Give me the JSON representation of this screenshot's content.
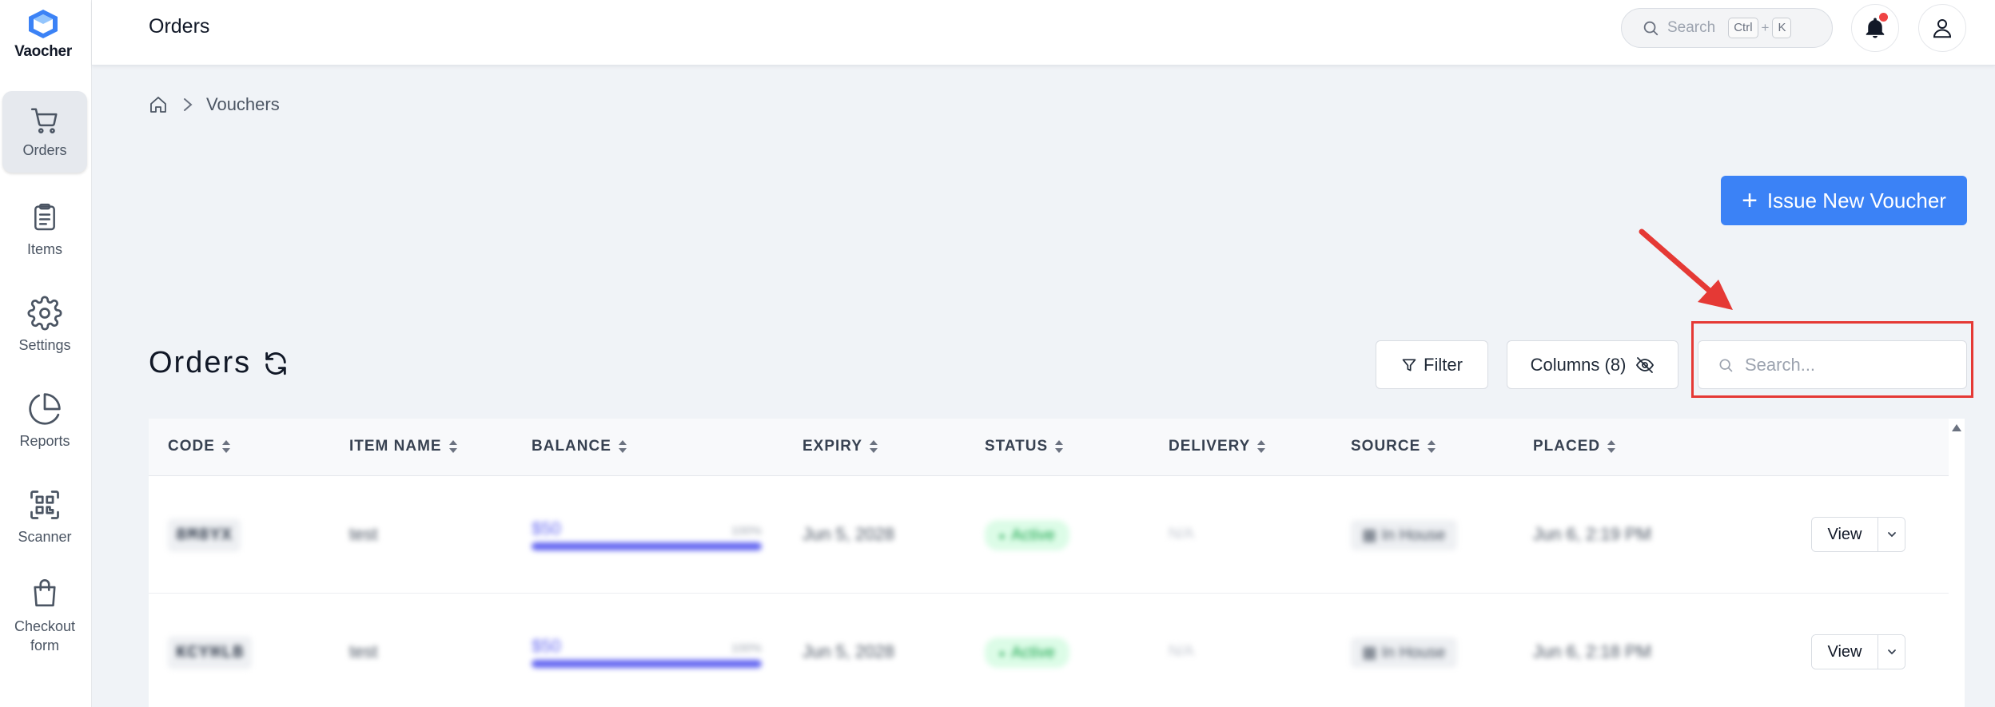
{
  "app": {
    "brand": "Vaocher"
  },
  "sidebar": {
    "items": [
      {
        "label": "Orders",
        "icon": "cart-icon",
        "active": true
      },
      {
        "label": "Items",
        "icon": "clipboard-icon",
        "active": false
      },
      {
        "label": "Settings",
        "icon": "gear-icon",
        "active": false
      },
      {
        "label": "Reports",
        "icon": "pie-chart-icon",
        "active": false
      },
      {
        "label": "Scanner",
        "icon": "qr-scan-icon",
        "active": false
      },
      {
        "label": "Checkout form",
        "icon": "shopping-bag-icon",
        "active": false
      }
    ]
  },
  "header": {
    "title": "Orders",
    "search": {
      "label": "Search",
      "kbd_ctrl": "Ctrl",
      "kbd_plus": "+",
      "kbd_key": "K"
    },
    "has_notification": true
  },
  "breadcrumb": {
    "home_icon": "home-icon",
    "current": "Vouchers"
  },
  "actions": {
    "issue_label": "Issue New Voucher"
  },
  "section": {
    "title": "Orders",
    "filter_label": "Filter",
    "columns_label": "Columns (8)",
    "search_placeholder": "Search..."
  },
  "table": {
    "columns": [
      "CODE",
      "ITEM NAME",
      "BALANCE",
      "EXPIRY",
      "STATUS",
      "DELIVERY",
      "SOURCE",
      "PLACED"
    ],
    "rows": [
      {
        "code": "8M8YX",
        "item_name": "test",
        "balance": "$50",
        "balance_pct": "100%",
        "balance_fraction": 1.0,
        "expiry": "Jun 5, 2028",
        "status": "Active",
        "delivery": "N/A",
        "source": "In House",
        "placed": "Jun 6, 2:19 PM",
        "view_label": "View"
      },
      {
        "code": "KCYHLB",
        "item_name": "test",
        "balance": "$50",
        "balance_pct": "100%",
        "balance_fraction": 1.0,
        "expiry": "Jun 5, 2028",
        "status": "Active",
        "delivery": "N/A",
        "source": "In House",
        "placed": "Jun 6, 2:18 PM",
        "view_label": "View"
      }
    ]
  },
  "colors": {
    "accent": "#3b82f6",
    "highlight": "#e53935",
    "balance_bar": "#6366f1",
    "status_active": "#16a34a"
  }
}
